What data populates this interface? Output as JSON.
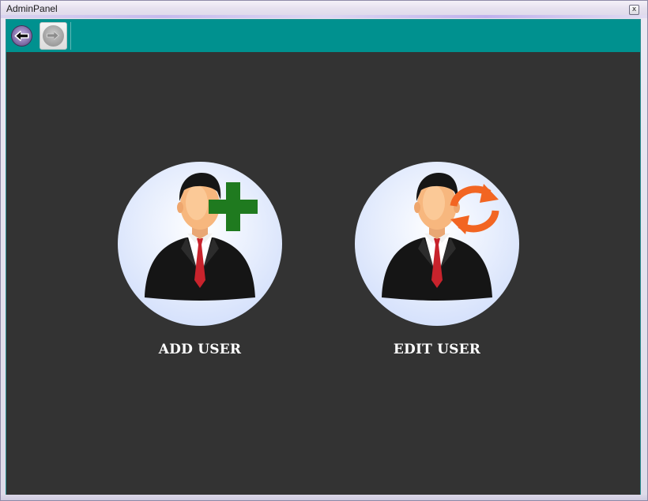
{
  "window": {
    "title": "AdminPanel",
    "close_glyph": "x"
  },
  "toolbar": {
    "back_icon": "back-arrow-icon",
    "forward_icon": "forward-arrow-icon",
    "accent_color": "#00918f"
  },
  "tiles": [
    {
      "label": "ADD USER",
      "icon": "add-user-icon",
      "badge_color": "#1f7a1f"
    },
    {
      "label": "EDIT USER",
      "icon": "edit-user-icon",
      "badge_color": "#f26522"
    }
  ],
  "colors": {
    "client_background": "#333333",
    "label_text": "#ffffff"
  }
}
